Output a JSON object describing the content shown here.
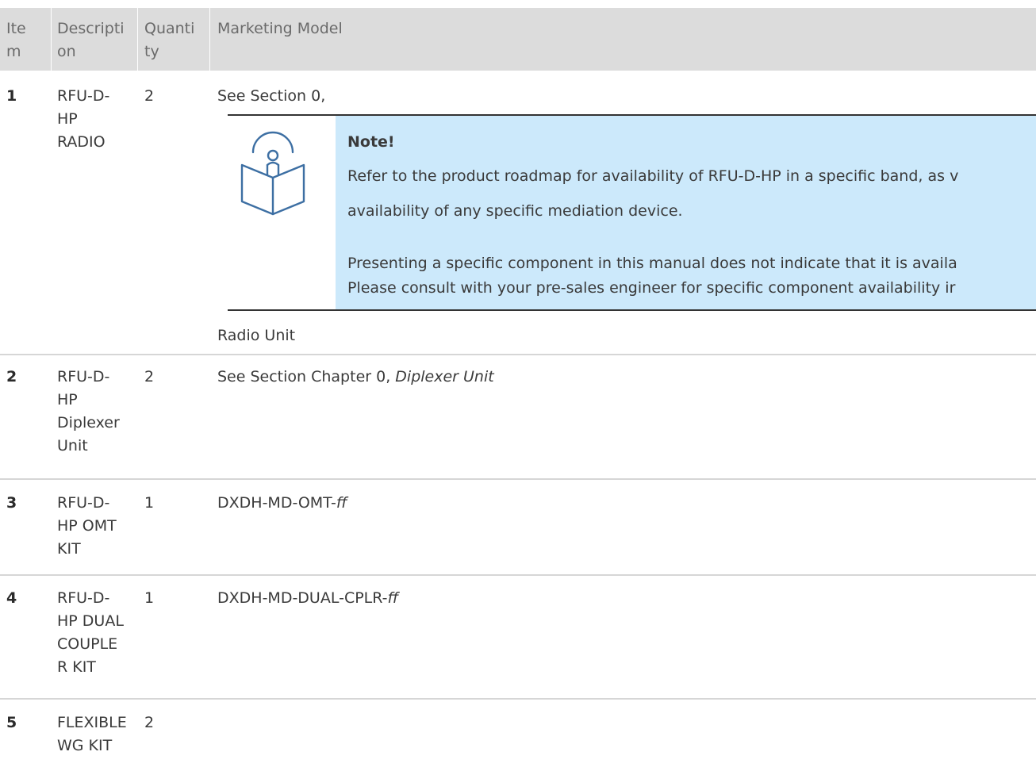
{
  "table": {
    "headers": {
      "item": [
        "Ite",
        "m"
      ],
      "description": [
        "Descripti",
        "on"
      ],
      "quantity": [
        "Quanti",
        "ty"
      ],
      "model": "Marketing Model"
    },
    "rows": [
      {
        "item": "1",
        "description": [
          "RFU-D-",
          "HP",
          "RADIO"
        ],
        "quantity": "2",
        "model_lines": [
          "See Section 0,",
          "Radio Unit"
        ]
      },
      {
        "item": "2",
        "description": [
          "RFU-D-",
          "HP",
          "Diplexer",
          "Unit"
        ],
        "quantity": "2",
        "model_prefix": "See Section Chapter 0, ",
        "model_italic": "Diplexer Unit"
      },
      {
        "item": "3",
        "description": [
          "RFU-D-",
          "HP OMT",
          "KIT"
        ],
        "quantity": "1",
        "model_prefix": "DXDH-MD-OMT-",
        "model_italic": "ff"
      },
      {
        "item": "4",
        "description": [
          "RFU-D-",
          "HP DUAL",
          "COUPLE",
          "R KIT"
        ],
        "quantity": "1",
        "model_prefix": "DXDH-MD-DUAL-CPLR-",
        "model_italic": "ff"
      },
      {
        "item": "5",
        "description": [
          "FLEXIBLE",
          "WG KIT"
        ],
        "quantity": "2"
      }
    ]
  },
  "note": {
    "icon": "book-icon",
    "title": "Note!",
    "lines": [
      "Refer to the product roadmap for availability of RFU-D-HP in a specific band, as v",
      "availability of any specific mediation device.",
      "Presenting a specific component in this manual does not indicate that it is availa",
      "Please consult with your pre-sales engineer for specific component availability ir"
    ]
  },
  "colors": {
    "header_bg": "#dcdcdc",
    "note_bg": "#cce9fb",
    "icon_stroke": "#3d6fa3",
    "rule": "#d6d6d6"
  }
}
